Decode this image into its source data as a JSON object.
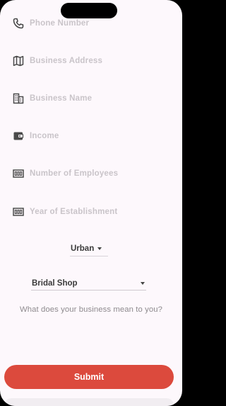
{
  "form": {
    "fields": [
      {
        "icon": "phone-icon",
        "placeholder": "Phone Number"
      },
      {
        "icon": "map-icon",
        "placeholder": "Business Address"
      },
      {
        "icon": "building-icon",
        "placeholder": "Business Name"
      },
      {
        "icon": "wallet-icon",
        "placeholder": "Income"
      },
      {
        "icon": "counter-icon",
        "placeholder": "Number of Employees"
      },
      {
        "icon": "counter-icon",
        "placeholder": "Year of Establishment"
      }
    ],
    "location_dropdown": {
      "value": "Urban"
    },
    "business_type_dropdown": {
      "value": "Bridal Shop"
    },
    "question": "What does your business mean to you?",
    "submit_label": "Submit"
  },
  "colors": {
    "background": "#fdf8fc",
    "placeholder": "#c9c4c9",
    "icon": "#4a4a4a",
    "accent": "#dc4a3d"
  }
}
